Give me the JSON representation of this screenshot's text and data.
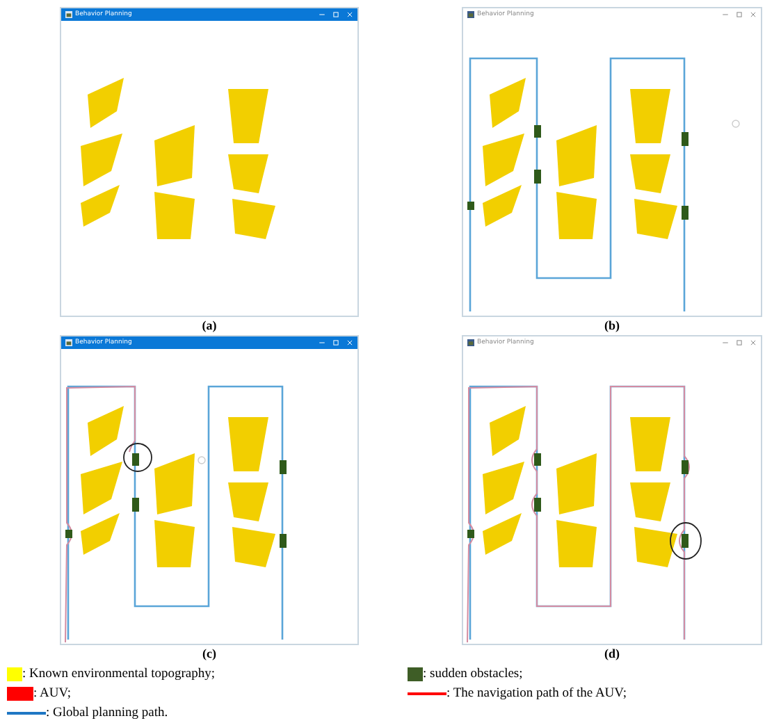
{
  "panels": [
    {
      "window": {
        "title": "Behavior Planning",
        "active": true
      },
      "kind": "terrain",
      "caption": "(a)"
    },
    {
      "window": {
        "title": "Behavior Planning",
        "active": false
      },
      "kind": "global_plan",
      "caption": "(b)"
    },
    {
      "window": {
        "title": "Behavior Planning",
        "active": true
      },
      "kind": "replan_partial",
      "caption": "(c)"
    },
    {
      "window": {
        "title": "Behavior Planning",
        "active": false
      },
      "kind": "replan_full",
      "caption": "(d)"
    }
  ],
  "legend": [
    {
      "kind": "square",
      "color": "#ffff00",
      "label": ": Known environmental topography;"
    },
    {
      "kind": "square",
      "color": "#3e5d26",
      "label": ": sudden obstacles;"
    },
    {
      "kind": "wide_square",
      "color": "#ff0000",
      "label": ": AUV;"
    },
    {
      "kind": "line",
      "color": "#ff0000",
      "label": ": The navigation path of the AUV;"
    },
    {
      "kind": "line",
      "color": "#1f77c4",
      "label": ": Global planning path."
    }
  ]
}
